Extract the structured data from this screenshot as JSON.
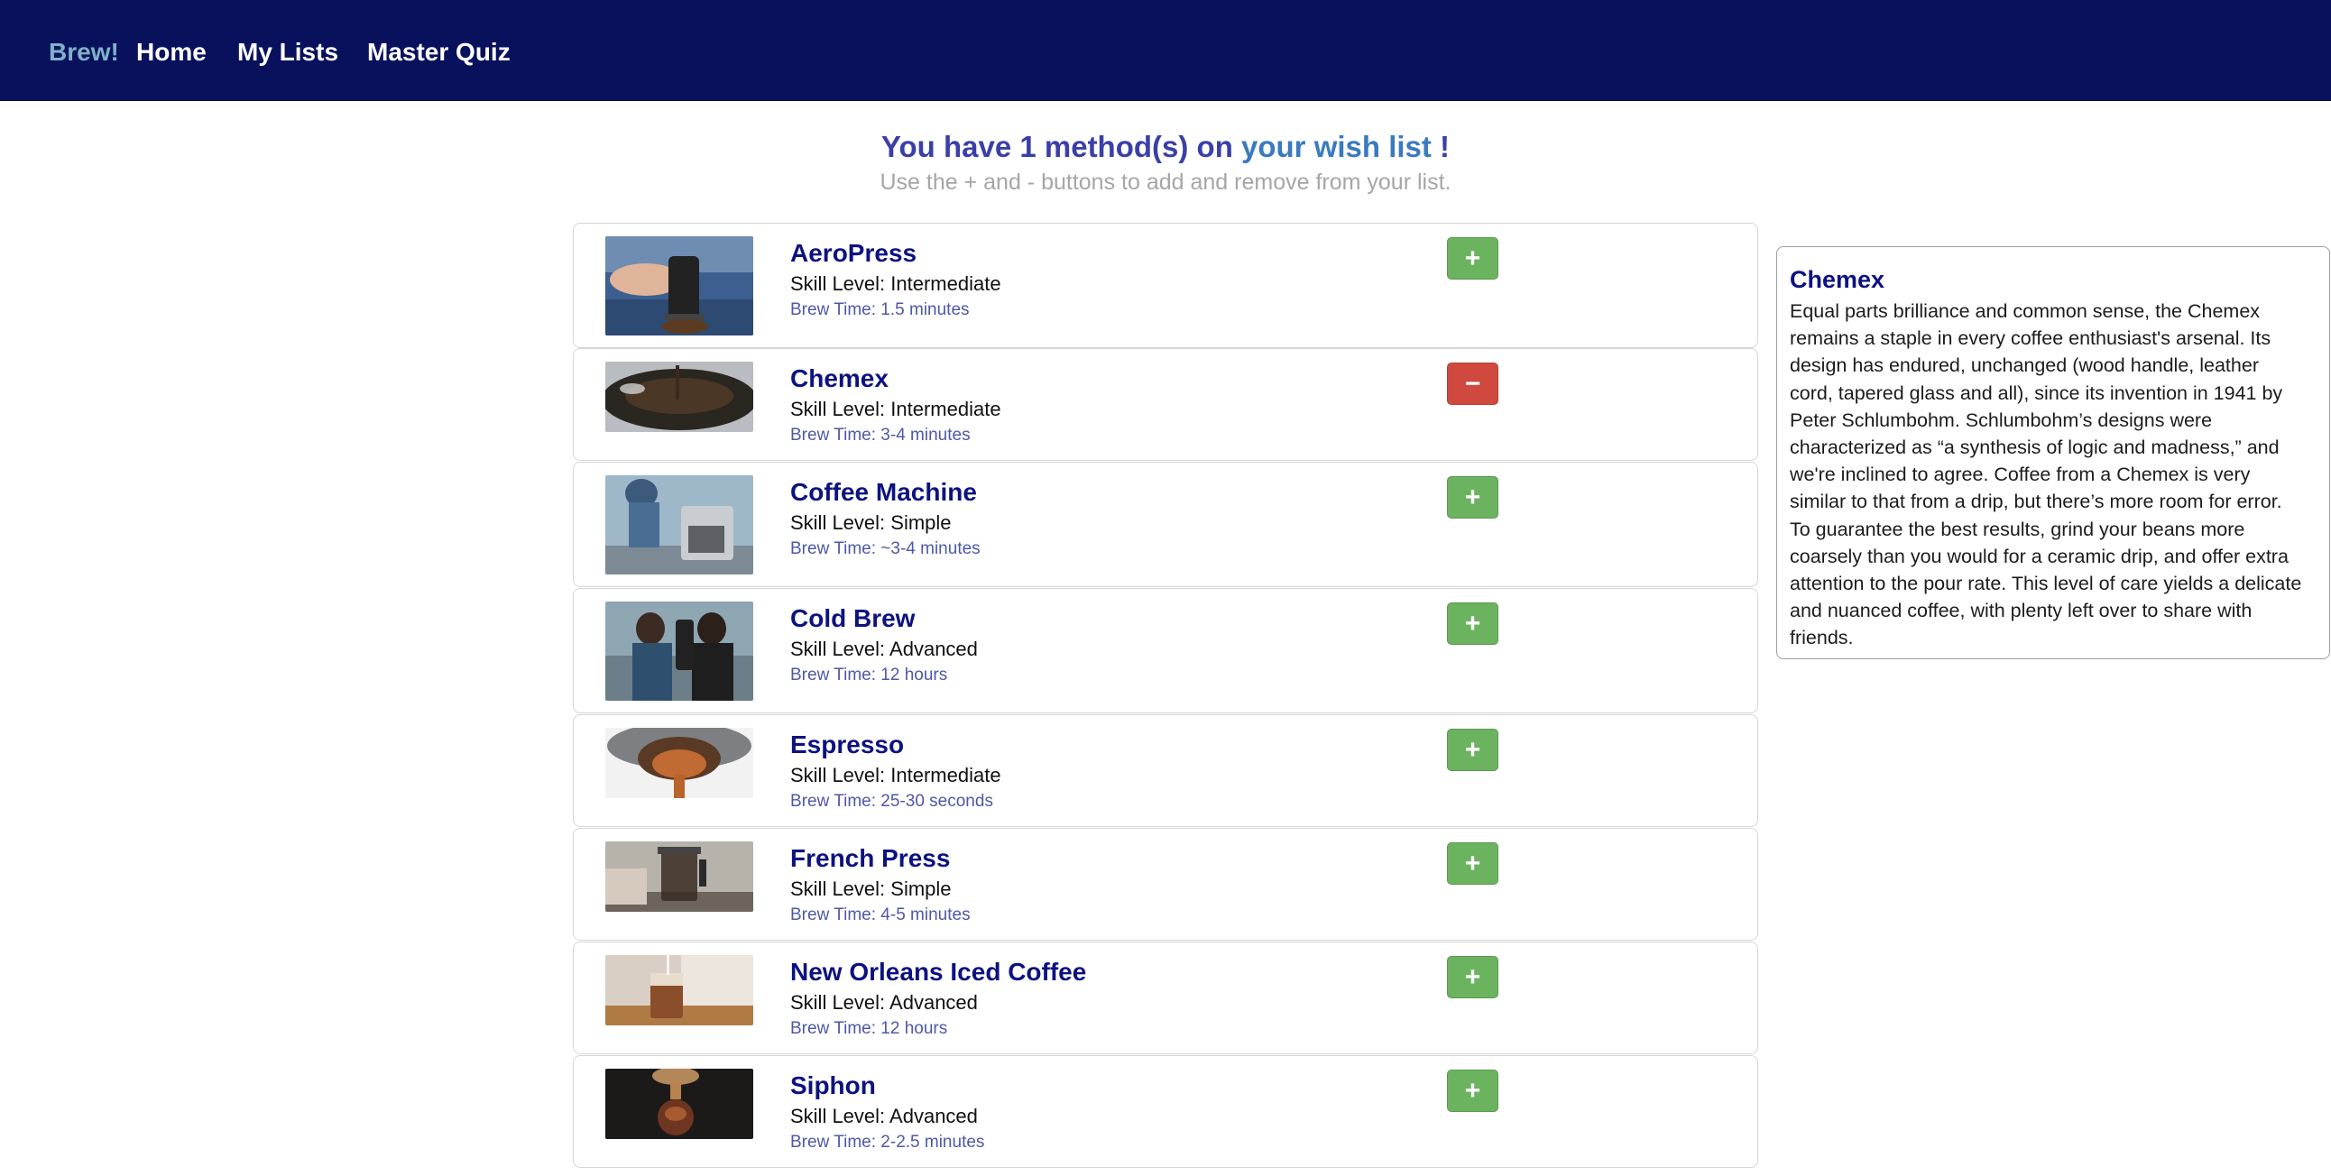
{
  "nav": {
    "brand": "Brew!",
    "links": [
      "Home",
      "My Lists",
      "Master Quiz"
    ]
  },
  "header": {
    "prefix": "You have 1 method(s) on ",
    "link": "your wish list",
    "suffix": " !",
    "subtitle": "Use the + and - buttons to add and remove from your list."
  },
  "methods": [
    {
      "name": "AeroPress",
      "skill": "Skill Level: Intermediate",
      "time": "Brew Time: 1.5 minutes",
      "button": "+",
      "on_list": false
    },
    {
      "name": "Chemex",
      "skill": "Skill Level: Intermediate",
      "time": "Brew Time: 3-4 minutes",
      "button": "−",
      "on_list": true
    },
    {
      "name": "Coffee Machine",
      "skill": "Skill Level: Simple",
      "time": "Brew Time: ~3-4 minutes",
      "button": "+",
      "on_list": false
    },
    {
      "name": "Cold Brew",
      "skill": "Skill Level: Advanced",
      "time": "Brew Time: 12 hours",
      "button": "+",
      "on_list": false
    },
    {
      "name": "Espresso",
      "skill": "Skill Level: Intermediate",
      "time": "Brew Time: 25-30 seconds",
      "button": "+",
      "on_list": false
    },
    {
      "name": "French Press",
      "skill": "Skill Level: Simple",
      "time": "Brew Time: 4-5 minutes",
      "button": "+",
      "on_list": false
    },
    {
      "name": "New Orleans Iced Coffee",
      "skill": "Skill Level: Advanced",
      "time": "Brew Time: 12 hours",
      "button": "+",
      "on_list": false
    },
    {
      "name": "Siphon",
      "skill": "Skill Level: Advanced",
      "time": "Brew Time: 2-2.5 minutes",
      "button": "+",
      "on_list": false
    }
  ],
  "detail": {
    "title": "Chemex",
    "lines": [
      "Equal parts brilliance and common sense, the Chemex",
      "remains a staple in every coffee enthusiast's arsenal. Its",
      "design has endured, unchanged (wood handle, leather",
      "cord, tapered glass and all), since its invention in 1941 by",
      "Peter Schlumbohm. Schlumbohm’s designs were",
      "characterized as “a synthesis of logic and madness,” and",
      "we're inclined to agree. Coffee from a Chemex is very",
      "similar to that from a drip, but there’s more room for error.",
      "To guarantee the best results, grind your beans more",
      "coarsely than you would for a ceramic drip, and offer extra",
      "attention to the pour rate. This level of care yields a delicate",
      "and nuanced coffee, with plenty left over to share with",
      "friends."
    ]
  },
  "colors": {
    "navbar": "#0a115c",
    "brand": "#7fb1c9",
    "heading": "#3a3fa8",
    "link": "#3a7abf",
    "method_name": "#0d1280",
    "add_button": "#6cb35f",
    "remove_button": "#d0493f"
  }
}
